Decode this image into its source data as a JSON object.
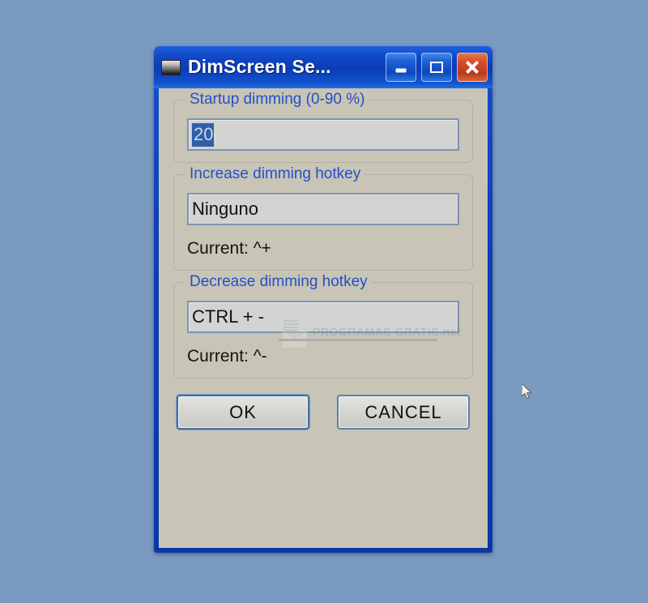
{
  "desktop": {
    "background_color": "#7b9ac0"
  },
  "window": {
    "title": "DimScreen Se...",
    "icon": "dim-screen-icon",
    "frame_color": "#0f3fb5",
    "client_background": "#c8c4b6",
    "controls": {
      "minimize": "minimize-icon",
      "maximize": "maximize-icon",
      "close": "close-icon"
    }
  },
  "groups": [
    {
      "title": "Startup dimming (0-90 %)",
      "field": {
        "value": "20",
        "selected": true,
        "placeholder": ""
      },
      "current": ""
    },
    {
      "title": "Increase dimming hotkey",
      "field": {
        "value": "Ninguno",
        "selected": false,
        "placeholder": ""
      },
      "current": "Current: ^+"
    },
    {
      "title": "Decrease dimming hotkey",
      "field": {
        "value": "CTRL + -",
        "selected": false,
        "placeholder": ""
      },
      "current": "Current: ^-"
    }
  ],
  "buttons": {
    "ok": "OK",
    "cancel": "CANCEL"
  },
  "watermark": {
    "text": "PROGRAMAS GRATIS.net"
  },
  "colors": {
    "title_blue": "#2350c8",
    "selection_blue": "#2f5fa8",
    "close_red": "#c44a22"
  }
}
